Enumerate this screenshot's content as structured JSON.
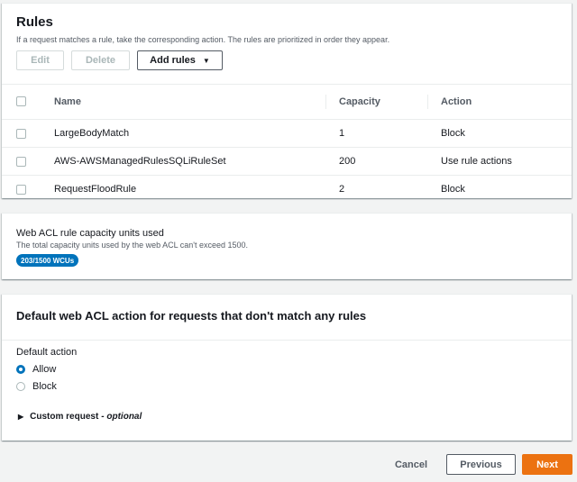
{
  "rules": {
    "title": "Rules",
    "description": "If a request matches a rule, take the corresponding action. The rules are prioritized in order they appear.",
    "buttons": {
      "edit": "Edit",
      "delete": "Delete",
      "add_rules": "Add rules"
    },
    "columns": [
      "Name",
      "Capacity",
      "Action"
    ],
    "rows": [
      {
        "name": "LargeBodyMatch",
        "capacity": "1",
        "action": "Block"
      },
      {
        "name": "AWS-AWSManagedRulesSQLiRuleSet",
        "capacity": "200",
        "action": "Use rule actions"
      },
      {
        "name": "RequestFloodRule",
        "capacity": "2",
        "action": "Block"
      }
    ]
  },
  "capacity": {
    "title": "Web ACL rule capacity units used",
    "description": "The total capacity units used by the web ACL can't exceed 1500.",
    "badge": "203/1500 WCUs"
  },
  "default_action": {
    "title": "Default web ACL action for requests that don't match any rules",
    "label": "Default action",
    "options": [
      {
        "label": "Allow",
        "selected": true
      },
      {
        "label": "Block",
        "selected": false
      }
    ],
    "custom_request": "Custom request",
    "custom_request_suffix": "- optional"
  },
  "footer": {
    "cancel": "Cancel",
    "previous": "Previous",
    "next": "Next"
  },
  "colors": {
    "primary": "#ec7211",
    "accent": "#0073bb"
  }
}
